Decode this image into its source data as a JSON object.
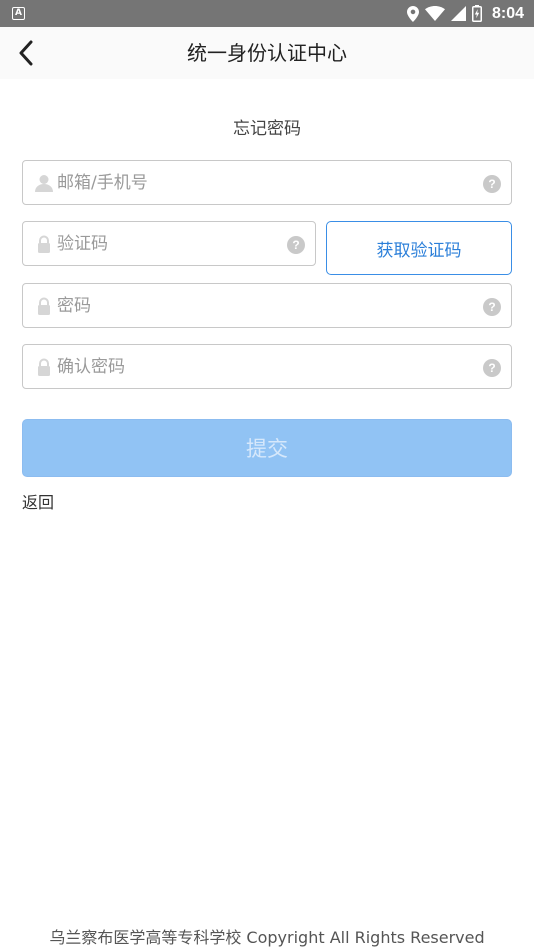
{
  "status_bar": {
    "notification_icon_letter": "A",
    "time": "8:04",
    "icons": [
      "location-icon",
      "wifi-icon",
      "signal-icon",
      "battery-icon"
    ]
  },
  "header": {
    "title": "统一身份认证中心",
    "back_icon": "chevron-left-icon"
  },
  "form": {
    "subtitle": "忘记密码",
    "account_placeholder": "邮箱/手机号",
    "code_placeholder": "验证码",
    "get_code_label": "获取验证码",
    "password_placeholder": "密码",
    "confirm_placeholder": "确认密码",
    "help_label": "?",
    "submit_label": "提交",
    "back_label": "返回"
  },
  "footer": {
    "text": "乌兰察布医学高等专科学校 Copyright All Rights Reserved"
  },
  "colors": {
    "accent": "#2b7fd9",
    "submit_bg": "#91c3f4",
    "status_bar": "#757575"
  }
}
